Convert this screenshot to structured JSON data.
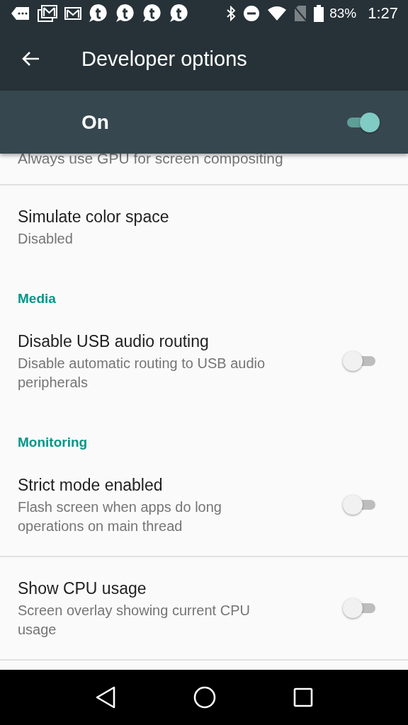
{
  "status_bar": {
    "battery": "83%",
    "time": "1:27"
  },
  "toolbar": {
    "title": "Developer options"
  },
  "master_switch": {
    "label": "On",
    "checked": true
  },
  "items": [
    {
      "kind": "item",
      "title": "Always use GPU for screen compositing"
    },
    {
      "kind": "item",
      "title": "Simulate color space",
      "summary": "Disabled"
    },
    {
      "kind": "category",
      "title": "Media"
    },
    {
      "kind": "switch",
      "title": "Disable USB audio routing",
      "summary": "Disable automatic routing to USB audio peripherals",
      "checked": false
    },
    {
      "kind": "category",
      "title": "Monitoring"
    },
    {
      "kind": "switch",
      "title": "Strict mode enabled",
      "summary": "Flash screen when apps do long operations on main thread",
      "checked": false
    },
    {
      "kind": "switch",
      "title": "Show CPU usage",
      "summary": "Screen overlay showing current CPU usage",
      "checked": false
    }
  ]
}
